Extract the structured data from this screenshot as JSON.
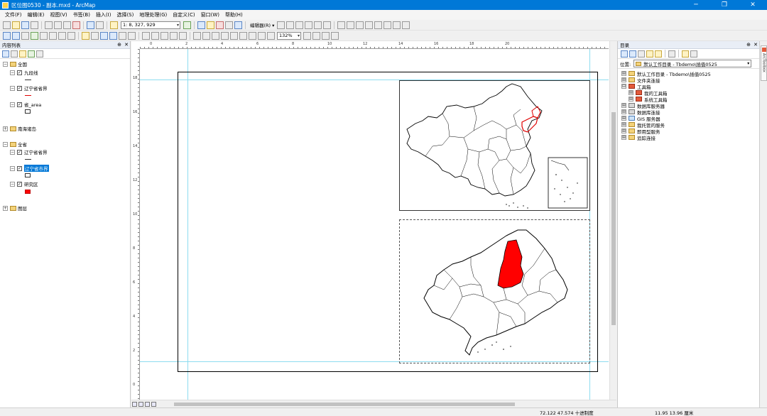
{
  "window": {
    "title": "区位图0530 - 副本.mxd - ArcMap",
    "minimize": "─",
    "maximize": "❐",
    "close": "✕"
  },
  "menu": [
    "文件(F)",
    "编辑(E)",
    "视图(V)",
    "书签(B)",
    "插入(I)",
    "选择(S)",
    "地理处理(G)",
    "自定义(C)",
    "窗口(W)",
    "帮助(H)"
  ],
  "toolbar": {
    "scale": "1: 8, 327, 929",
    "editor_label": "编辑器(R) ▾",
    "zoom_percent": "132%"
  },
  "toc": {
    "title": "内容列表",
    "pin": "⊕",
    "close": "✕",
    "frame1": {
      "name": "全国",
      "layers": [
        {
          "name": "九段线",
          "symbol": "line-black"
        },
        {
          "name": "辽宁省省界",
          "symbol": "line-red"
        },
        {
          "name": "省_area",
          "symbol": "box"
        }
      ]
    },
    "frame2": {
      "name": "南海诸岛"
    },
    "frame3": {
      "name": "全省",
      "layers": [
        {
          "name": "辽宁省省界",
          "symbol": "line-black"
        },
        {
          "name": "辽宁省市界",
          "symbol": "box",
          "selected": true
        },
        {
          "name": "研究区",
          "symbol": "box-red"
        }
      ]
    },
    "frame4": {
      "name": "图层"
    }
  },
  "ruler": {
    "h": [
      "0",
      "2",
      "4",
      "6",
      "8",
      "10",
      "12",
      "14",
      "16",
      "18",
      "20"
    ],
    "v": [
      "18",
      "16",
      "14",
      "12",
      "10",
      "8",
      "6",
      "4",
      "2",
      "0"
    ]
  },
  "catalog": {
    "title": "目录",
    "pin": "⊕",
    "close": "✕",
    "location_label": "位置:",
    "location_value": "默认工作目录 - Tbdemo\\插值0525",
    "items": [
      {
        "label": "默认工作目录 - Tbdemo\\插值0525",
        "icon": "folder-icon",
        "level": 0,
        "expander": "⊞"
      },
      {
        "label": "文件夹连接",
        "icon": "folder-icon",
        "level": 0,
        "expander": "⊞"
      },
      {
        "label": "工具箱",
        "icon": "toolbox-icon",
        "level": 0,
        "expander": "⊟"
      },
      {
        "label": "我的工具箱",
        "icon": "toolbox-icon",
        "level": 1,
        "expander": "⊞"
      },
      {
        "label": "系统工具箱",
        "icon": "toolbox-icon",
        "level": 1,
        "expander": "⊞"
      },
      {
        "label": "数据库服务器",
        "icon": "database-icon",
        "level": 0,
        "expander": "⊞"
      },
      {
        "label": "数据库连接",
        "icon": "database-icon",
        "level": 0,
        "expander": "⊞"
      },
      {
        "label": "GIS 服务器",
        "icon": "gis-server-icon",
        "level": 0,
        "expander": "⊞"
      },
      {
        "label": "我托管的服务",
        "icon": "folder-icon",
        "level": 0,
        "expander": "⊞"
      },
      {
        "label": "即用型服务",
        "icon": "folder-icon",
        "level": 0,
        "expander": "⊞"
      },
      {
        "label": "追踪连接",
        "icon": "folder-icon",
        "level": 0,
        "expander": "⊞"
      }
    ]
  },
  "side_tab": {
    "label": "ArcToolbox"
  },
  "status": {
    "coords": "72.122  47.574 十进制度",
    "page_size": "11.95  13.96 厘米"
  },
  "colors": {
    "titlebar": "#0078d7",
    "study_area": "#ff0000",
    "boundary_highlight": "#e00000"
  }
}
